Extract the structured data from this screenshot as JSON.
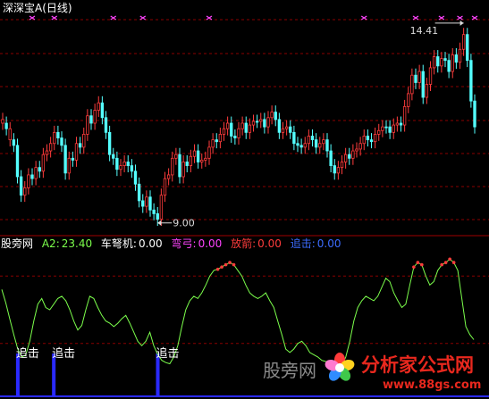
{
  "top_panel": {
    "title": "深深宝A",
    "period": "(日线)",
    "high_label": "14.41",
    "low_label": "9.00"
  },
  "bottom_panel": {
    "indicator_name": "股旁网",
    "a2_label": "A2:",
    "a2_value": "23.40",
    "crossbow_label": "车弩机:",
    "crossbow_value": "0.00",
    "bow_label": "弯弓:",
    "bow_value": "0.00",
    "release_label": "放箭:",
    "release_value": "0.00",
    "chase_label": "追击:",
    "chase_value": "0.00",
    "signal_text": "追击"
  },
  "watermark": {
    "left_text": "股旁网",
    "brand_text": "分析家公式网",
    "url_text": "www.88gs.com"
  },
  "colors": {
    "up_candle": "#ff3c3c",
    "down_candle": "#54ffff",
    "line": "#7cff4c",
    "overbought_marker": "#ff3c3c",
    "chase_bar": "#2a2aff",
    "cross_marker": "#ff44ff",
    "grid": "#8b0000"
  },
  "chart_data": [
    {
      "type": "candlestick",
      "title": "深深宝A (日线)",
      "ylim": [
        8.8,
        14.6
      ],
      "annotations": [
        {
          "text": "14.41",
          "kind": "max_price"
        },
        {
          "text": "9.00",
          "kind": "min_price"
        }
      ],
      "series": [
        {
          "name": "close",
          "values": [
            11.7,
            11.55,
            11.25,
            11.1,
            10.25,
            9.75,
            9.95,
            10.3,
            10.2,
            10.5,
            10.4,
            10.85,
            10.95,
            11.15,
            11.45,
            11.3,
            11.1,
            10.35,
            10.75,
            10.7,
            11.15,
            11.05,
            11.4,
            11.9,
            11.7,
            12.05,
            12.25,
            11.85,
            11.45,
            10.85,
            10.75,
            10.45,
            10.55,
            10.65,
            10.55,
            10.4,
            10.05,
            9.6,
            9.45,
            9.7,
            9.35,
            9.25,
            9.1,
            9.75,
            10.2,
            10.3,
            10.75,
            10.85,
            10.25,
            10.65,
            10.55,
            10.8,
            10.95,
            10.65,
            10.7,
            10.75,
            11.05,
            11.25,
            11.2,
            11.4,
            11.55,
            11.7,
            11.35,
            11.3,
            11.55,
            11.7,
            11.45,
            11.65,
            11.75,
            11.75,
            11.8,
            11.6,
            11.85,
            12.0,
            11.8,
            11.45,
            11.55,
            11.6,
            11.45,
            11.15,
            11.1,
            11.05,
            11.15,
            11.35,
            11.25,
            11.05,
            11.15,
            11.25,
            10.95,
            10.55,
            10.35,
            10.5,
            10.65,
            10.85,
            10.75,
            10.95,
            11.0,
            11.15,
            11.35,
            11.25,
            11.2,
            11.4,
            11.5,
            11.6,
            11.6,
            11.45,
            11.65,
            11.7,
            11.65,
            12.15,
            12.5,
            13.0,
            12.8,
            13.1,
            12.4,
            12.75,
            13.2,
            13.5,
            13.25,
            13.45,
            13.4,
            13.1,
            13.55,
            13.35,
            13.7,
            14.1,
            13.4,
            12.3,
            11.6
          ]
        },
        {
          "name": "kind",
          "values": [
            "up",
            "down",
            "up",
            "down",
            "down",
            "down",
            "up",
            "up",
            "down",
            "up",
            "down",
            "up",
            "up",
            "up",
            "up",
            "down",
            "down",
            "down",
            "up",
            "down",
            "up",
            "down",
            "up",
            "up",
            "down",
            "up",
            "up",
            "down",
            "down",
            "down",
            "down",
            "down",
            "up",
            "up",
            "down",
            "down",
            "down",
            "down",
            "down",
            "up",
            "down",
            "down",
            "down",
            "up",
            "up",
            "up",
            "up",
            "up",
            "down",
            "up",
            "down",
            "up",
            "up",
            "down",
            "up",
            "up",
            "up",
            "up",
            "down",
            "up",
            "up",
            "up",
            "down",
            "down",
            "up",
            "up",
            "down",
            "up",
            "up",
            "down",
            "up",
            "down",
            "up",
            "up",
            "down",
            "down",
            "up",
            "up",
            "down",
            "down",
            "down",
            "down",
            "up",
            "up",
            "down",
            "down",
            "up",
            "up",
            "down",
            "down",
            "down",
            "up",
            "up",
            "up",
            "down",
            "up",
            "up",
            "up",
            "up",
            "down",
            "down",
            "up",
            "up",
            "up",
            "down",
            "down",
            "up",
            "up",
            "down",
            "up",
            "up",
            "up",
            "down",
            "up",
            "down",
            "up",
            "up",
            "up",
            "down",
            "up",
            "down",
            "down",
            "up",
            "down",
            "up",
            "up",
            "down",
            "down",
            "down"
          ]
        }
      ]
    },
    {
      "type": "line",
      "title": "股旁网",
      "ylim": [
        0,
        100
      ],
      "series": [
        {
          "name": "A2",
          "values": [
            68,
            56,
            42,
            28,
            15,
            8,
            10,
            22,
            40,
            55,
            60,
            52,
            50,
            55,
            60,
            62,
            58,
            50,
            40,
            32,
            36,
            50,
            62,
            60,
            52,
            45,
            40,
            38,
            35,
            38,
            42,
            45,
            38,
            30,
            22,
            18,
            22,
            30,
            18,
            10,
            5,
            3,
            2,
            8,
            18,
            35,
            50,
            58,
            62,
            60,
            65,
            72,
            80,
            85,
            86,
            88,
            90,
            92,
            90,
            85,
            80,
            72,
            65,
            62,
            60,
            62,
            65,
            58,
            52,
            40,
            28,
            15,
            12,
            15,
            20,
            22,
            18,
            12,
            10,
            8,
            5,
            4,
            3,
            2,
            1,
            0,
            8,
            22,
            40,
            52,
            58,
            62,
            60,
            58,
            62,
            70,
            78,
            75,
            65,
            58,
            52,
            55,
            72,
            88,
            92,
            90,
            80,
            72,
            75,
            85,
            90,
            92,
            95,
            92,
            85,
            60,
            35,
            28,
            23.4
          ]
        },
        {
          "name": "chase_signal_index",
          "values": [
            4,
            13,
            39
          ]
        }
      ]
    }
  ]
}
